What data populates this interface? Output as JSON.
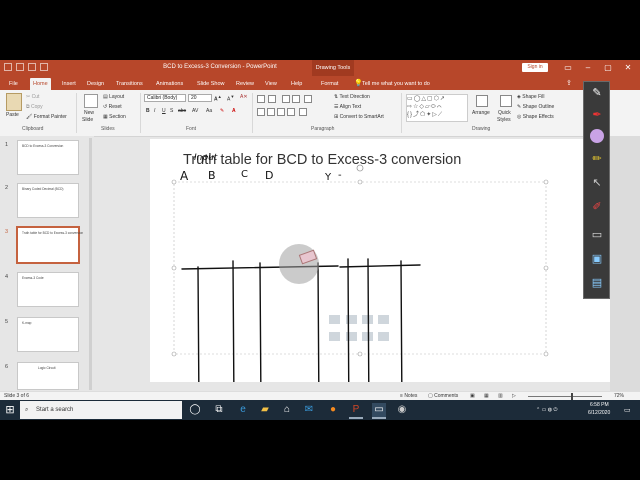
{
  "title_bar": {
    "doc_title": "BCD to Excess-3 Conversion  -  PowerPoint",
    "context_title": "Drawing Tools",
    "signin_label": "Sign in"
  },
  "tabs": [
    "File",
    "Home",
    "Insert",
    "Design",
    "Transitions",
    "Animations",
    "Slide Show",
    "Review",
    "View",
    "Help",
    "Format"
  ],
  "active_tab": "Home",
  "tell_me": "Tell me what you want to do",
  "ribbon": {
    "clipboard": {
      "paste": "Paste",
      "cut": "Cut",
      "copy": "Copy",
      "format_painter": "Format Painter",
      "label": "Clipboard"
    },
    "slides": {
      "new_slide": "New",
      "new_slide2": "Slide",
      "layout": "Layout",
      "reset": "Reset",
      "section": "Section",
      "label": "Slides"
    },
    "font": {
      "font_name": "Calibri (Body)",
      "font_size": "20",
      "label": "Font"
    },
    "paragraph": {
      "text_direction": "Text Direction",
      "align_text": "Align Text",
      "smartart": "Convert to SmartArt",
      "label": "Paragraph"
    },
    "drawing": {
      "arrange": "Arrange",
      "quick_styles": "Quick",
      "quick_styles2": "Styles",
      "shape_fill": "Shape Fill",
      "shape_outline": "Shape Outline",
      "shape_effects": "Shape Effects",
      "label": "Drawing"
    }
  },
  "slides": [
    {
      "num": "1",
      "text": "BCD to Excess-3 Conversion"
    },
    {
      "num": "2",
      "text": "Binary Coded Decimal (BCD)"
    },
    {
      "num": "3",
      "text": "Truth table for BCD to Excess-3 conversion"
    },
    {
      "num": "4",
      "text": "Excess-3 Code"
    },
    {
      "num": "5",
      "text": "K-map"
    },
    {
      "num": "6",
      "text": "Logic Circuit"
    }
  ],
  "slide": {
    "title": "Truth table for BCD to Excess-3 conversion",
    "ink_input": "Input",
    "ink_cols": [
      "A",
      "B",
      "C",
      "D"
    ],
    "ink_out": "Y",
    "ink_dash": "-"
  },
  "status": {
    "slide_info": "Slide 3 of 6",
    "notes": "Notes",
    "comments": "Comments",
    "zoom": "72%"
  },
  "taskbar": {
    "search": "Start a search",
    "time": "6:58 PM",
    "date": "6/12/2020"
  },
  "colors": {
    "accent": "#b7472a",
    "taskbar": "#1c2b39"
  }
}
